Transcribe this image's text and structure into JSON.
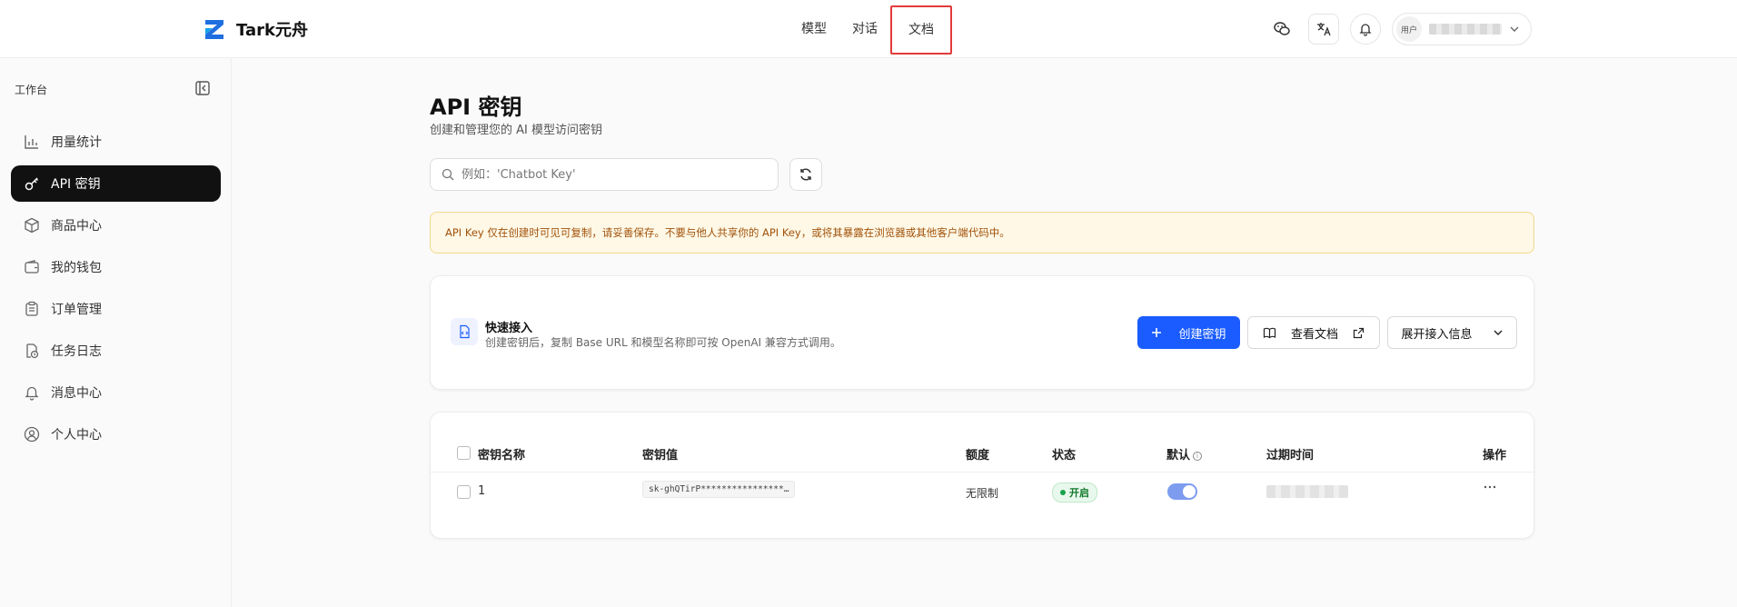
{
  "header": {
    "logo_text": "Tark元舟",
    "nav": [
      "模型",
      "对话",
      "文档"
    ],
    "user_avatar_text": "用户"
  },
  "sidebar": {
    "title": "工作台",
    "items": [
      {
        "label": "用量统计",
        "icon": "bar-chart-icon"
      },
      {
        "label": "API 密钥",
        "icon": "key-icon",
        "active": true
      },
      {
        "label": "商品中心",
        "icon": "package-icon"
      },
      {
        "label": "我的钱包",
        "icon": "wallet-icon"
      },
      {
        "label": "订单管理",
        "icon": "clipboard-icon"
      },
      {
        "label": "任务日志",
        "icon": "task-log-icon"
      },
      {
        "label": "消息中心",
        "icon": "bell-icon"
      },
      {
        "label": "个人中心",
        "icon": "user-circle-icon"
      }
    ]
  },
  "page": {
    "title": "API 密钥",
    "subtitle": "创建和管理您的 AI 模型访问密钥",
    "search_placeholder": "例如：'Chatbot Key'",
    "alert": "API Key 仅在创建时可见可复制，请妥善保存。不要与他人共享你的 API Key，或将其暴露在浏览器或其他客户端代码中。"
  },
  "quick": {
    "title": "快速接入",
    "desc": "创建密钥后，复制 Base URL 和模型名称即可按 OpenAI 兼容方式调用。",
    "create_label": "创建密钥",
    "docs_label": "查看文档",
    "expand_label": "展开接入信息"
  },
  "table": {
    "headers": {
      "name": "密钥名称",
      "value": "密钥值",
      "quota": "额度",
      "status": "状态",
      "default": "默认",
      "expire": "过期时间",
      "actions": "操作"
    },
    "rows": [
      {
        "name": "1",
        "value": "sk-ghQTirP****************…",
        "quota": "无限制",
        "status": "开启",
        "default_on": true
      }
    ]
  },
  "colors": {
    "primary": "#1a5cff",
    "nav_highlight": "#e23b3b",
    "alert_bg": "#fff8e6",
    "status_green": "#1aa34a"
  }
}
